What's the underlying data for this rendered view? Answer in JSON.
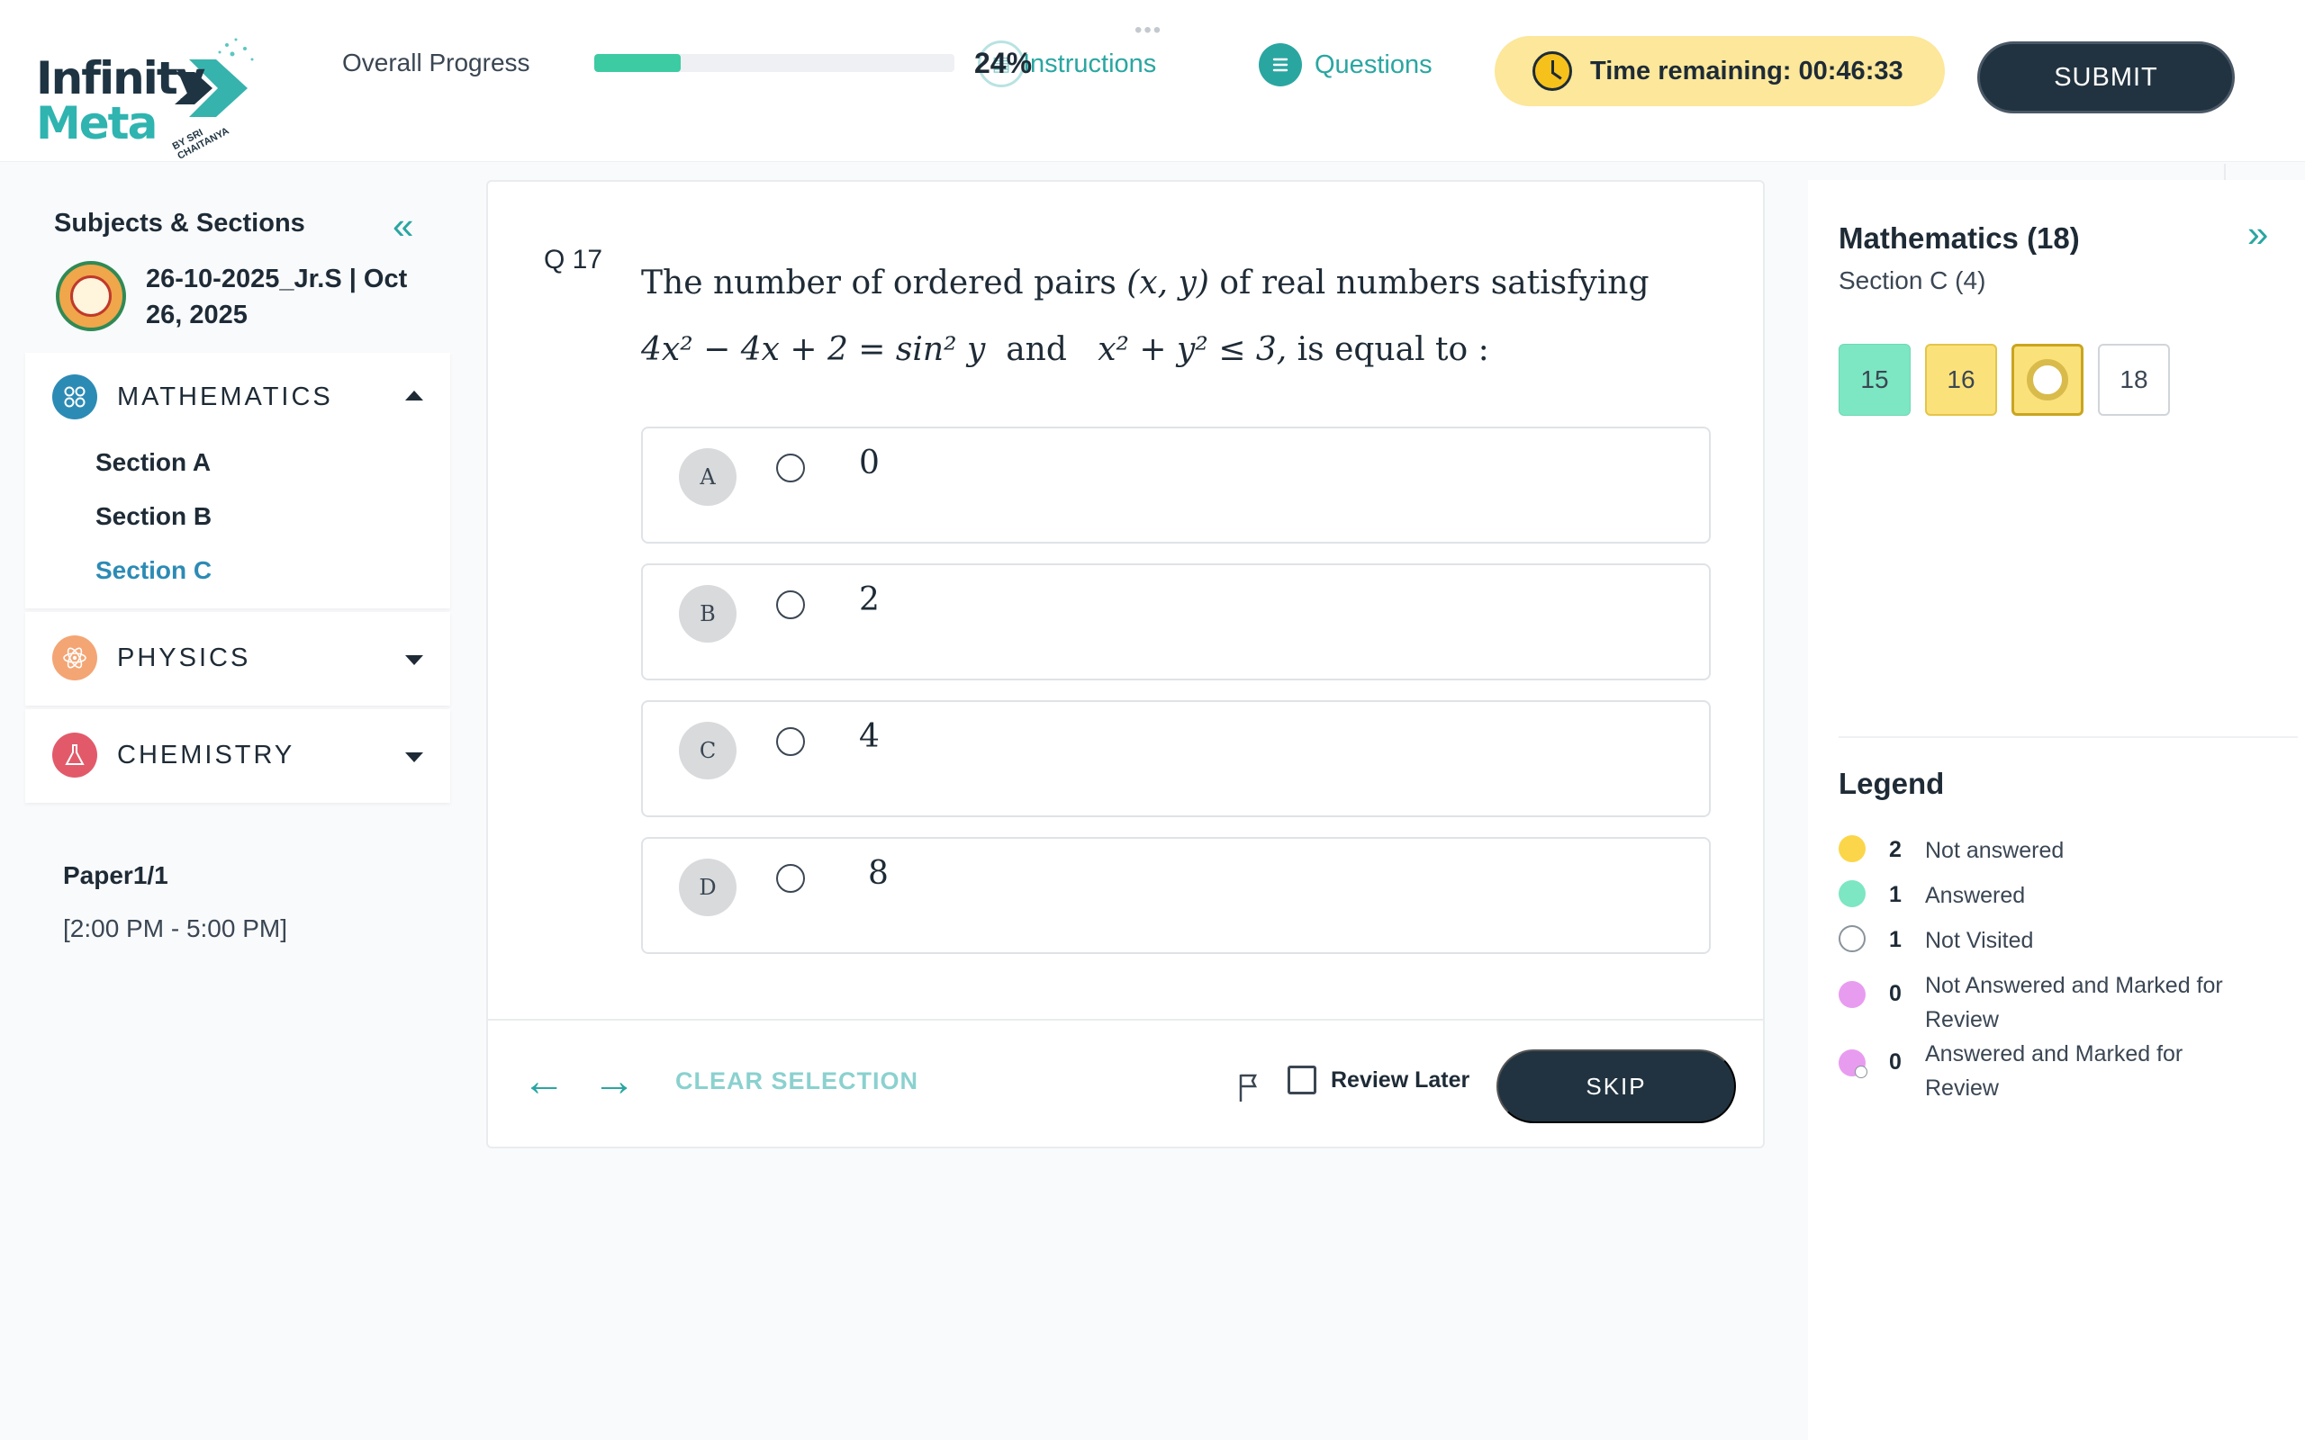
{
  "header": {
    "logo_line1": "Infinity",
    "logo_line2": "Meta",
    "logo_tagline": "BY SRI CHAITANYA",
    "progress_label": "Overall Progress",
    "progress_value": 24,
    "progress_text": "24%",
    "instructions_label": "Instructions",
    "questions_label": "Questions",
    "timer_text": "Time remaining: 00:46:33",
    "submit_label": "SUBMIT"
  },
  "sidebar": {
    "title": "Subjects & Sections",
    "exam_name": "26-10-2025_Jr.S | Oct 26, 2025",
    "subjects": [
      {
        "name": "MATHEMATICS",
        "color": "#2c8bb5",
        "icon": "grid-icon",
        "expanded": true,
        "sections": [
          "Section A",
          "Section B",
          "Section C"
        ],
        "active_section": "Section C"
      },
      {
        "name": "PHYSICS",
        "color": "#f4a574",
        "icon": "atom-icon",
        "expanded": false
      },
      {
        "name": "CHEMISTRY",
        "color": "#e25a6a",
        "icon": "flask-icon",
        "expanded": false
      }
    ],
    "paper_name": "Paper1/1",
    "paper_time": "[2:00 PM - 5:00 PM]"
  },
  "question": {
    "number": "Q 17",
    "text_line1_prefix": "The number of ordered pairs",
    "text_line1_var": "(x, y)",
    "text_line1_suffix": "of real numbers satisfying",
    "text_line2_eq1": "4x² − 4x + 2 = sin² y",
    "text_line2_and": "and",
    "text_line2_eq2": "x² + y² ≤ 3,",
    "text_line2_suffix": "is equal to :",
    "options": [
      {
        "letter": "A",
        "value": "0"
      },
      {
        "letter": "B",
        "value": "2"
      },
      {
        "letter": "C",
        "value": "4"
      },
      {
        "letter": "D",
        "value": "8"
      }
    ],
    "clear_label": "CLEAR SELECTION",
    "review_label": "Review Later",
    "skip_label": "SKIP"
  },
  "palette": {
    "title": "Mathematics (18)",
    "section": "Section C (4)",
    "questions": [
      {
        "num": "15",
        "status": "answered"
      },
      {
        "num": "16",
        "status": "notans"
      },
      {
        "num": "",
        "status": "current"
      },
      {
        "num": "18",
        "status": "notvisited"
      }
    ],
    "legend_title": "Legend",
    "legend": [
      {
        "count": "2",
        "label": "Not answered",
        "color": "#fbd64a"
      },
      {
        "count": "1",
        "label": "Answered",
        "color": "#7de6c3"
      },
      {
        "count": "1",
        "label": "Not Visited",
        "color": "#ffffff"
      },
      {
        "count": "0",
        "label": "Not Answered and Marked for Review",
        "color": "#e89cf0"
      },
      {
        "count": "0",
        "label": "Answered and Marked for Review",
        "color": "#e89cf0"
      }
    ]
  }
}
